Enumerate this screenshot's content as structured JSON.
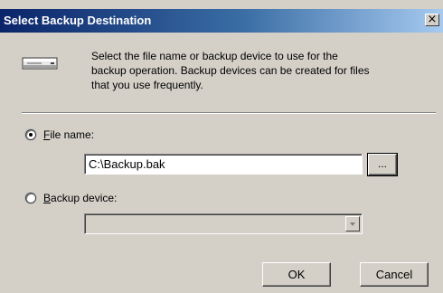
{
  "window": {
    "title": "Select Backup Destination",
    "close_glyph": "×"
  },
  "description": "Select the file name or backup device to use for the\nbackup operation.  Backup devices can be created for files\nthat you use frequently.",
  "icons": {
    "device": "tape-drive-icon"
  },
  "options": {
    "file_name": {
      "label_mnemonic": "F",
      "label_rest": "ile name:",
      "selected": true
    },
    "backup_device": {
      "label_mnemonic": "B",
      "label_rest": "ackup device:",
      "selected": false
    }
  },
  "file_name_value": "C:\\Backup.bak",
  "browse_label": "...",
  "backup_device_value": "",
  "buttons": {
    "ok": "OK",
    "cancel": "Cancel"
  },
  "colors": {
    "title_start": "#0a246a",
    "title_end": "#a6caf0",
    "face": "#d4d0c8"
  }
}
